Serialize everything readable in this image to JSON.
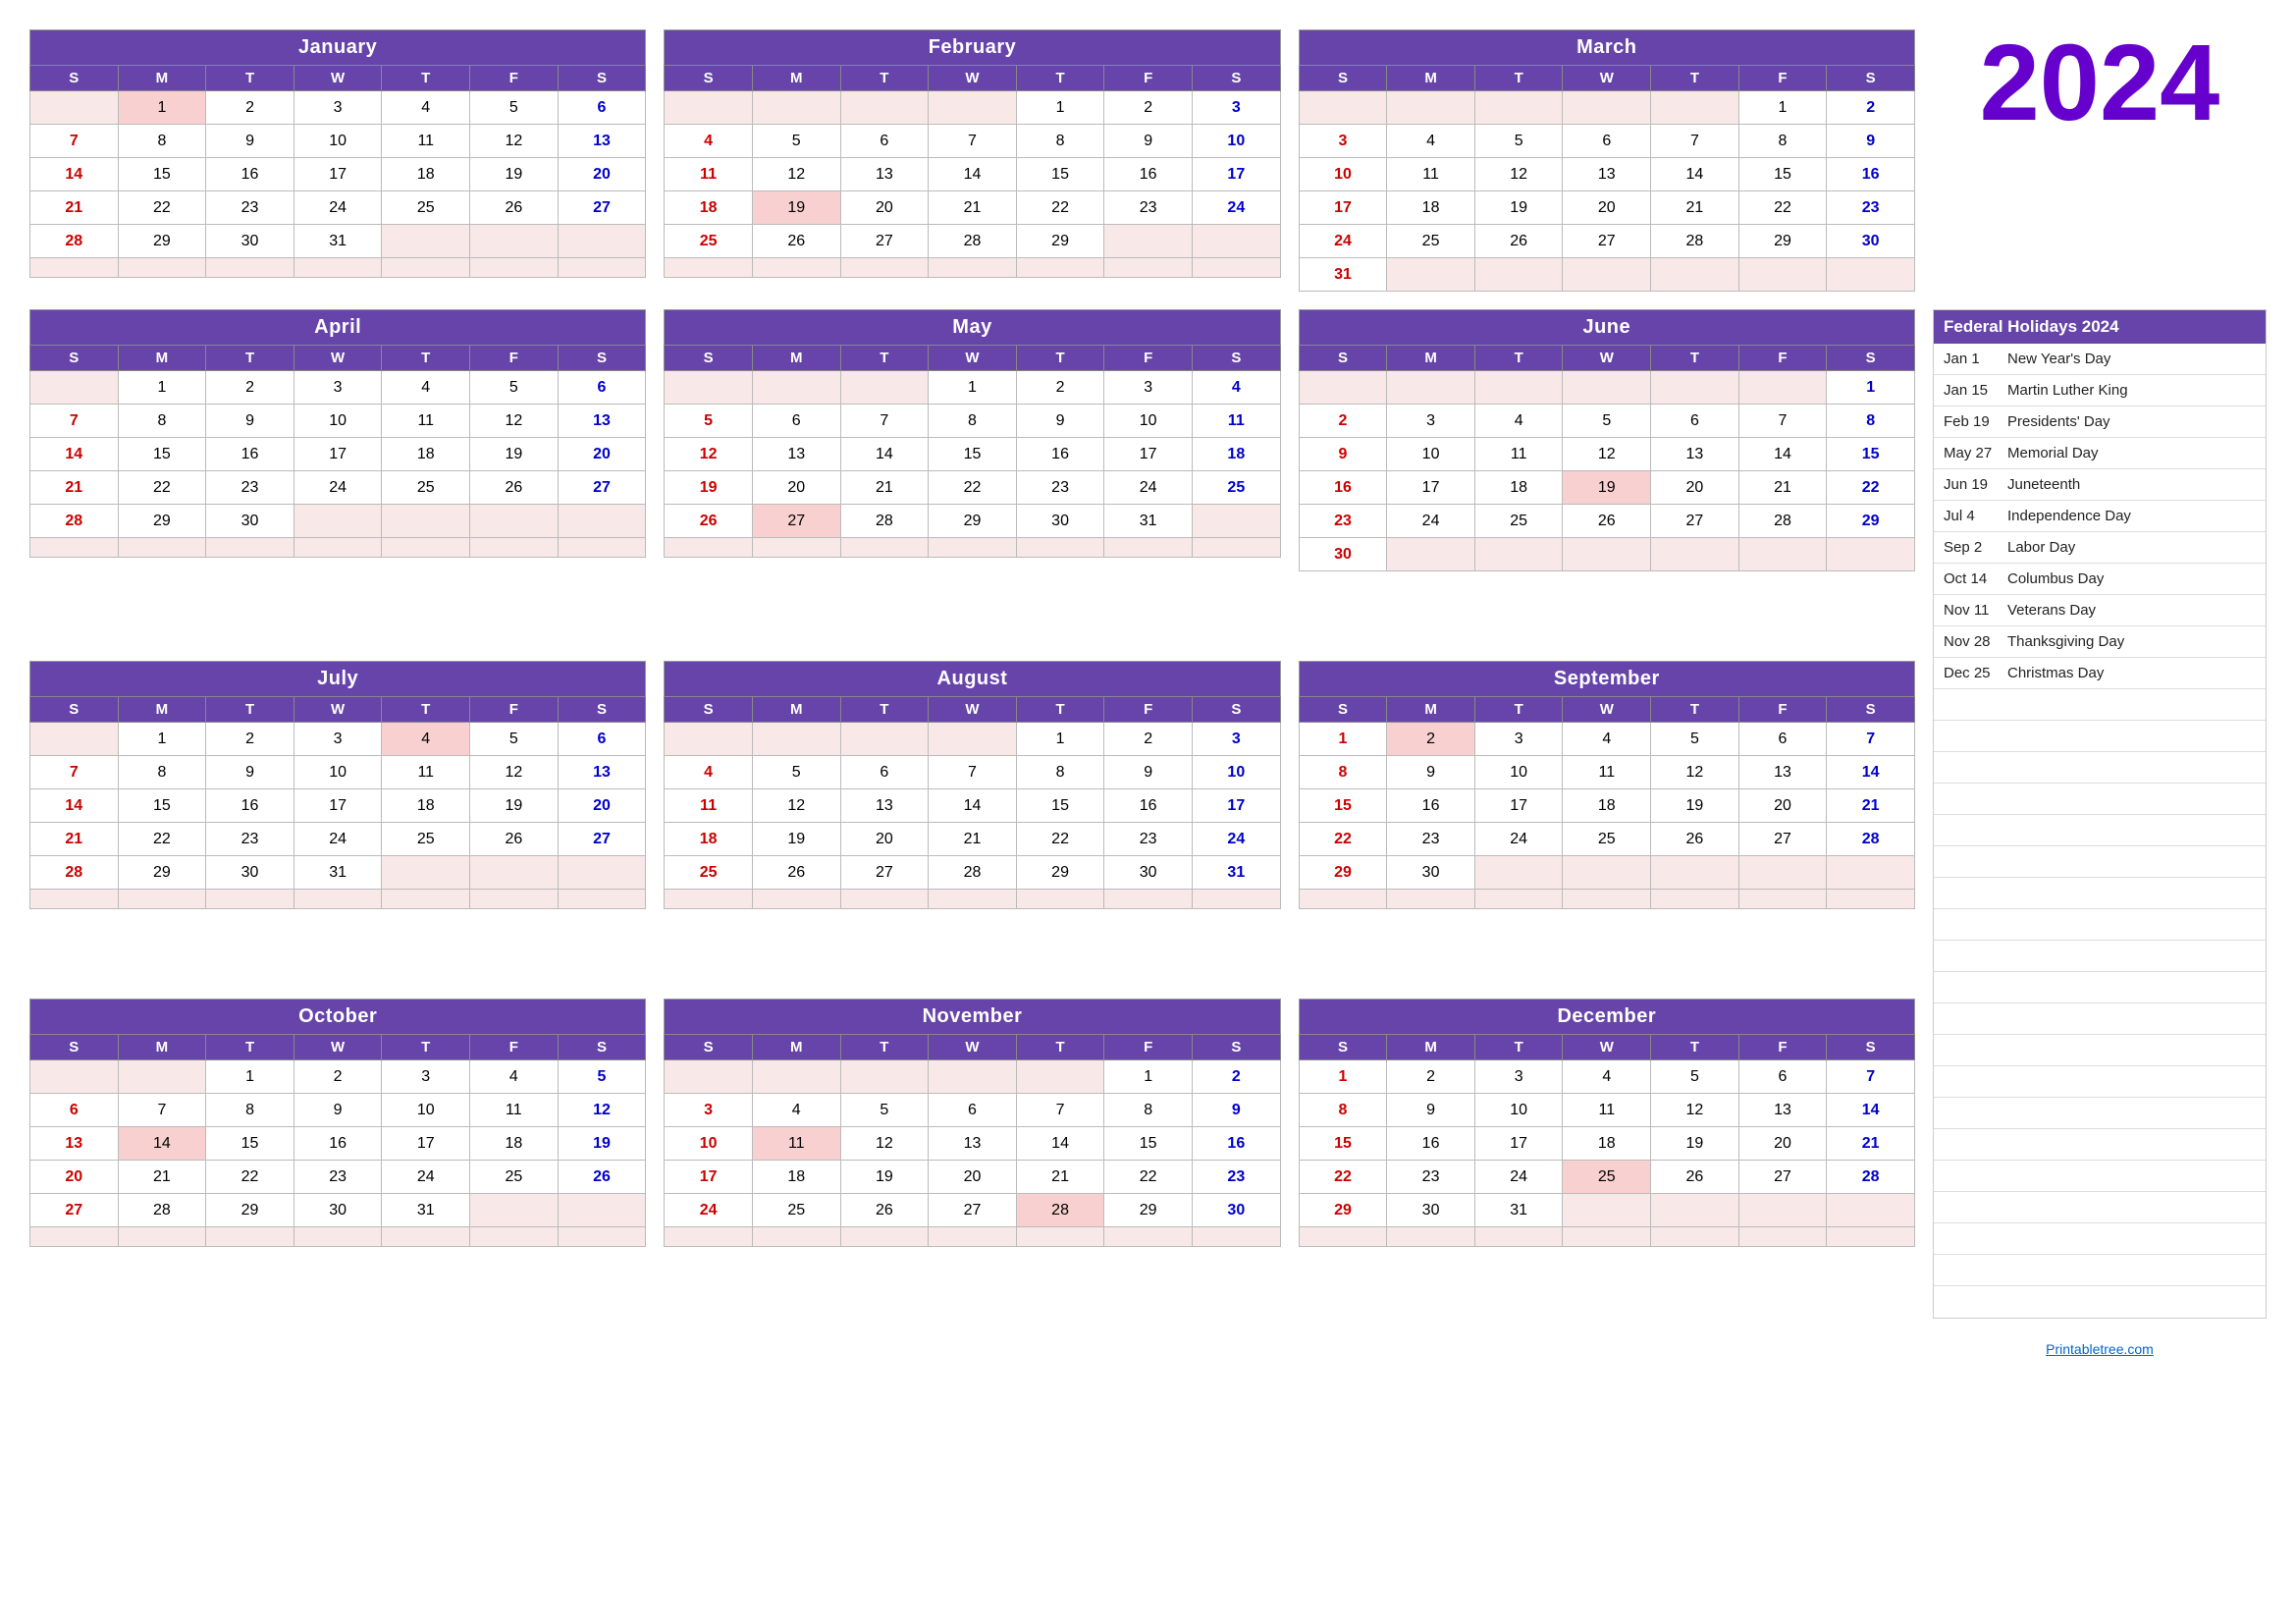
{
  "year": "2024",
  "holidays_header": "Federal Holidays 2024",
  "holidays": [
    {
      "date": "Jan 1",
      "name": "New Year's Day"
    },
    {
      "date": "Jan 15",
      "name": "Martin Luther King"
    },
    {
      "date": "Feb 19",
      "name": "Presidents' Day"
    },
    {
      "date": "May 27",
      "name": "Memorial Day"
    },
    {
      "date": "Jun 19",
      "name": "Juneteenth"
    },
    {
      "date": "Jul 4",
      "name": "Independence Day"
    },
    {
      "date": "Sep 2",
      "name": "Labor Day"
    },
    {
      "date": "Oct 14",
      "name": "Columbus Day"
    },
    {
      "date": "Nov 11",
      "name": "Veterans Day"
    },
    {
      "date": "Nov 28",
      "name": "Thanksgiving Day"
    },
    {
      "date": "Dec 25",
      "name": "Christmas Day"
    }
  ],
  "printable_link": "Printabletree.com",
  "months": [
    {
      "name": "January",
      "weeks": [
        [
          null,
          1,
          2,
          3,
          4,
          5,
          6
        ],
        [
          7,
          8,
          9,
          10,
          11,
          12,
          13
        ],
        [
          14,
          15,
          16,
          17,
          18,
          19,
          20
        ],
        [
          21,
          22,
          23,
          24,
          25,
          26,
          27
        ],
        [
          28,
          29,
          30,
          31,
          null,
          null,
          null
        ],
        [
          null,
          null,
          null,
          null,
          null,
          null,
          null
        ]
      ],
      "holidays": [
        1
      ]
    },
    {
      "name": "February",
      "weeks": [
        [
          null,
          null,
          null,
          null,
          1,
          2,
          3
        ],
        [
          4,
          5,
          6,
          7,
          8,
          9,
          10
        ],
        [
          11,
          12,
          13,
          14,
          15,
          16,
          17
        ],
        [
          18,
          19,
          20,
          21,
          22,
          23,
          24
        ],
        [
          25,
          26,
          27,
          28,
          29,
          null,
          null
        ],
        [
          null,
          null,
          null,
          null,
          null,
          null,
          null
        ]
      ],
      "holidays": [
        19
      ]
    },
    {
      "name": "March",
      "weeks": [
        [
          null,
          null,
          null,
          null,
          null,
          1,
          2
        ],
        [
          3,
          4,
          5,
          6,
          7,
          8,
          9
        ],
        [
          10,
          11,
          12,
          13,
          14,
          15,
          16
        ],
        [
          17,
          18,
          19,
          20,
          21,
          22,
          23
        ],
        [
          24,
          25,
          26,
          27,
          28,
          29,
          30
        ],
        [
          31,
          null,
          null,
          null,
          null,
          null,
          null
        ]
      ],
      "holidays": []
    },
    {
      "name": "April",
      "weeks": [
        [
          null,
          1,
          2,
          3,
          4,
          5,
          6
        ],
        [
          7,
          8,
          9,
          10,
          11,
          12,
          13
        ],
        [
          14,
          15,
          16,
          17,
          18,
          19,
          20
        ],
        [
          21,
          22,
          23,
          24,
          25,
          26,
          27
        ],
        [
          28,
          29,
          30,
          null,
          null,
          null,
          null
        ],
        [
          null,
          null,
          null,
          null,
          null,
          null,
          null
        ]
      ],
      "holidays": []
    },
    {
      "name": "May",
      "weeks": [
        [
          null,
          null,
          null,
          1,
          2,
          3,
          4
        ],
        [
          5,
          6,
          7,
          8,
          9,
          10,
          11
        ],
        [
          12,
          13,
          14,
          15,
          16,
          17,
          18
        ],
        [
          19,
          20,
          21,
          22,
          23,
          24,
          25
        ],
        [
          26,
          27,
          28,
          29,
          30,
          31,
          null
        ],
        [
          null,
          null,
          null,
          null,
          null,
          null,
          null
        ]
      ],
      "holidays": [
        27
      ]
    },
    {
      "name": "June",
      "weeks": [
        [
          null,
          null,
          null,
          null,
          null,
          null,
          1
        ],
        [
          2,
          3,
          4,
          5,
          6,
          7,
          8
        ],
        [
          9,
          10,
          11,
          12,
          13,
          14,
          15
        ],
        [
          16,
          17,
          18,
          19,
          20,
          21,
          22
        ],
        [
          23,
          24,
          25,
          26,
          27,
          28,
          29
        ],
        [
          30,
          null,
          null,
          null,
          null,
          null,
          null
        ]
      ],
      "holidays": [
        19
      ]
    },
    {
      "name": "July",
      "weeks": [
        [
          null,
          1,
          2,
          3,
          4,
          5,
          6
        ],
        [
          7,
          8,
          9,
          10,
          11,
          12,
          13
        ],
        [
          14,
          15,
          16,
          17,
          18,
          19,
          20
        ],
        [
          21,
          22,
          23,
          24,
          25,
          26,
          27
        ],
        [
          28,
          29,
          30,
          31,
          null,
          null,
          null
        ],
        [
          null,
          null,
          null,
          null,
          null,
          null,
          null
        ]
      ],
      "holidays": [
        4
      ]
    },
    {
      "name": "August",
      "weeks": [
        [
          null,
          null,
          null,
          null,
          1,
          2,
          3
        ],
        [
          4,
          5,
          6,
          7,
          8,
          9,
          10
        ],
        [
          11,
          12,
          13,
          14,
          15,
          16,
          17
        ],
        [
          18,
          19,
          20,
          21,
          22,
          23,
          24
        ],
        [
          25,
          26,
          27,
          28,
          29,
          30,
          31
        ],
        [
          null,
          null,
          null,
          null,
          null,
          null,
          null
        ]
      ],
      "holidays": []
    },
    {
      "name": "September",
      "weeks": [
        [
          1,
          2,
          3,
          4,
          5,
          6,
          7
        ],
        [
          8,
          9,
          10,
          11,
          12,
          13,
          14
        ],
        [
          15,
          16,
          17,
          18,
          19,
          20,
          21
        ],
        [
          22,
          23,
          24,
          25,
          26,
          27,
          28
        ],
        [
          29,
          30,
          null,
          null,
          null,
          null,
          null
        ],
        [
          null,
          null,
          null,
          null,
          null,
          null,
          null
        ]
      ],
      "holidays": [
        2
      ]
    },
    {
      "name": "October",
      "weeks": [
        [
          null,
          null,
          1,
          2,
          3,
          4,
          5
        ],
        [
          6,
          7,
          8,
          9,
          10,
          11,
          12
        ],
        [
          13,
          14,
          15,
          16,
          17,
          18,
          19
        ],
        [
          20,
          21,
          22,
          23,
          24,
          25,
          26
        ],
        [
          27,
          28,
          29,
          30,
          31,
          null,
          null
        ],
        [
          null,
          null,
          null,
          null,
          null,
          null,
          null
        ]
      ],
      "holidays": [
        14
      ]
    },
    {
      "name": "November",
      "weeks": [
        [
          null,
          null,
          null,
          null,
          null,
          1,
          2
        ],
        [
          3,
          4,
          5,
          6,
          7,
          8,
          9
        ],
        [
          10,
          11,
          12,
          13,
          14,
          15,
          16
        ],
        [
          17,
          18,
          19,
          20,
          21,
          22,
          23
        ],
        [
          24,
          25,
          26,
          27,
          28,
          29,
          30
        ],
        [
          null,
          null,
          null,
          null,
          null,
          null,
          null
        ]
      ],
      "holidays": [
        11,
        28
      ]
    },
    {
      "name": "December",
      "weeks": [
        [
          1,
          2,
          3,
          4,
          5,
          6,
          7
        ],
        [
          8,
          9,
          10,
          11,
          12,
          13,
          14
        ],
        [
          15,
          16,
          17,
          18,
          19,
          20,
          21
        ],
        [
          22,
          23,
          24,
          25,
          26,
          27,
          28
        ],
        [
          29,
          30,
          31,
          null,
          null,
          null,
          null
        ],
        [
          null,
          null,
          null,
          null,
          null,
          null,
          null
        ]
      ],
      "holidays": [
        25
      ]
    }
  ],
  "day_headers": [
    "S",
    "M",
    "T",
    "W",
    "T",
    "F",
    "S"
  ]
}
